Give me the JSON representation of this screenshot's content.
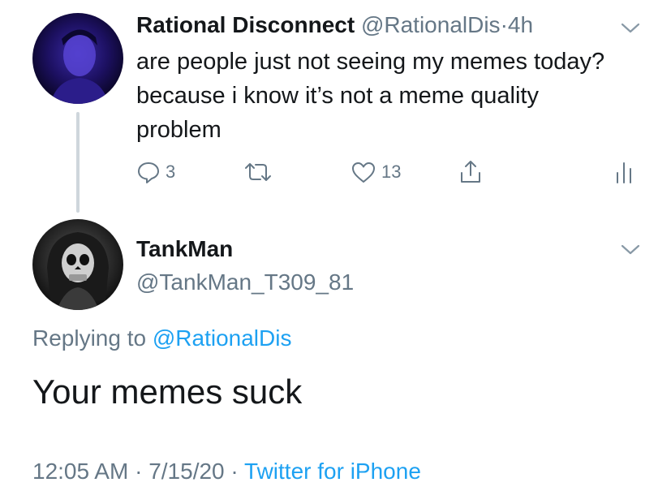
{
  "colors": {
    "text": "#14171a",
    "muted": "#657786",
    "link": "#1da1f2",
    "thread_line": "#cfd6dc"
  },
  "parent_tweet": {
    "display_name": "Rational Disconnect",
    "handle": "@RationalDis",
    "separator": "·",
    "time": "4h",
    "text": "are people just not seeing my memes today? because i know it’s not a meme quality problem",
    "avatar_icon": "user-avatar",
    "actions": {
      "reply": {
        "icon": "reply-icon",
        "count": "3"
      },
      "retweet": {
        "icon": "retweet-icon"
      },
      "like": {
        "icon": "heart-icon",
        "count": "13"
      },
      "share": {
        "icon": "share-icon"
      },
      "analytics": {
        "icon": "analytics-icon"
      }
    }
  },
  "reply_tweet": {
    "display_name": "TankMan",
    "handle": "@TankMan_T309_81",
    "avatar_icon": "skull-avatar",
    "replying_to_label": "Replying to",
    "replying_to_handle": "@RationalDis",
    "text": "Your memes suck",
    "time": "12:05 AM",
    "date": "7/15/20",
    "separator": "·",
    "source": "Twitter for iPhone"
  }
}
